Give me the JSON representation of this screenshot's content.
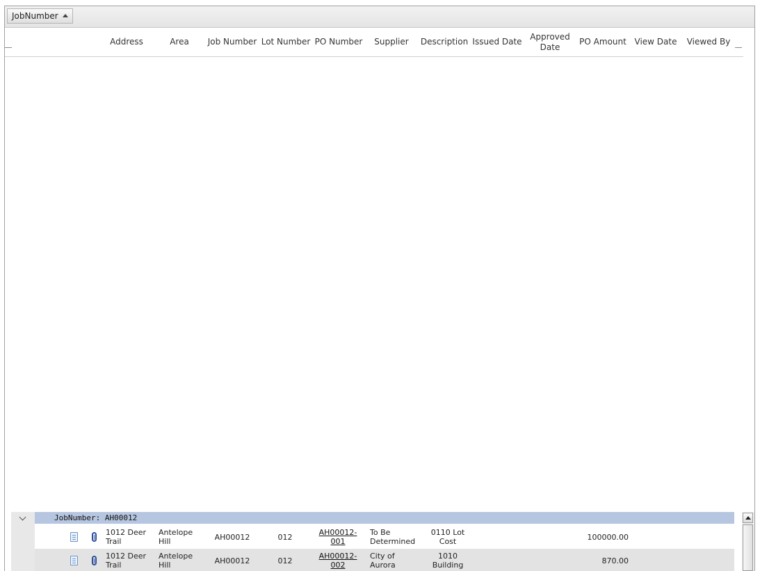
{
  "group_panel": {
    "chip_label": "JobNumber"
  },
  "columns": [
    {
      "label": "Address"
    },
    {
      "label": "Area"
    },
    {
      "label": "Job Number"
    },
    {
      "label": "Lot Number"
    },
    {
      "label": "PO Number"
    },
    {
      "label": "Supplier"
    },
    {
      "label": "Description"
    },
    {
      "label": "Issued Date"
    },
    {
      "label": "Approved Date"
    },
    {
      "label": "PO Amount"
    },
    {
      "label": "View Date"
    },
    {
      "label": "Viewed By"
    }
  ],
  "group": {
    "label": "JobNumber: AH00012"
  },
  "rows": [
    {
      "address": "1012 Deer Trail",
      "area": "Antelope Hill",
      "job_number": "AH00012",
      "lot_number": "012",
      "po_number": "AH00012-001",
      "supplier": "To Be Determined",
      "description": "0110 Lot Cost",
      "issued_date": "",
      "approved_date": "",
      "po_amount": "100000.00",
      "view_date": "",
      "viewed_by": ""
    },
    {
      "address": "1012 Deer Trail",
      "area": "Antelope Hill",
      "job_number": "AH00012",
      "lot_number": "012",
      "po_number": "AH00012-002",
      "supplier": "City of Aurora",
      "description": "1010 Building",
      "issued_date": "",
      "approved_date": "",
      "po_amount": "870.00",
      "view_date": "",
      "viewed_by": ""
    }
  ],
  "icons": {
    "document": "document-icon",
    "attachment": "paperclip-icon",
    "expand": "chevron-down-icon",
    "sort": "sort-ascending-icon"
  },
  "colors": {
    "group_row": "#b6c6e0",
    "alt_row": "#e3e3e3",
    "link": "#111111"
  }
}
